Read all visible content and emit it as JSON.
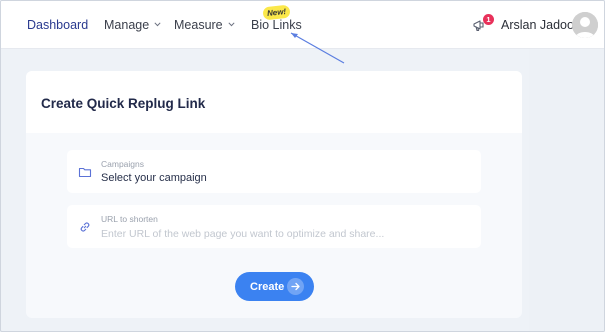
{
  "nav": {
    "items": [
      {
        "label": "Dashboard",
        "active": true
      },
      {
        "label": "Manage",
        "dropdown": true
      },
      {
        "label": "Measure",
        "dropdown": true
      },
      {
        "label": "Bio Links",
        "badge": "New!"
      }
    ],
    "notification_count": "1",
    "user_name": "Arslan Jadoon"
  },
  "card": {
    "title": "Create Quick Replug Link",
    "campaign_field": {
      "label": "Campaigns",
      "value": "Select your campaign",
      "icon": "folder-icon"
    },
    "url_field": {
      "label": "URL to shorten",
      "placeholder": "Enter URL of the web page you want to optimize and share...",
      "icon": "link-icon"
    },
    "create_label": "Create"
  },
  "colors": {
    "accent": "#3b82f1",
    "nav_active": "#2a3a8f",
    "badge_new": "#fbe84a",
    "notif": "#e8315a"
  }
}
